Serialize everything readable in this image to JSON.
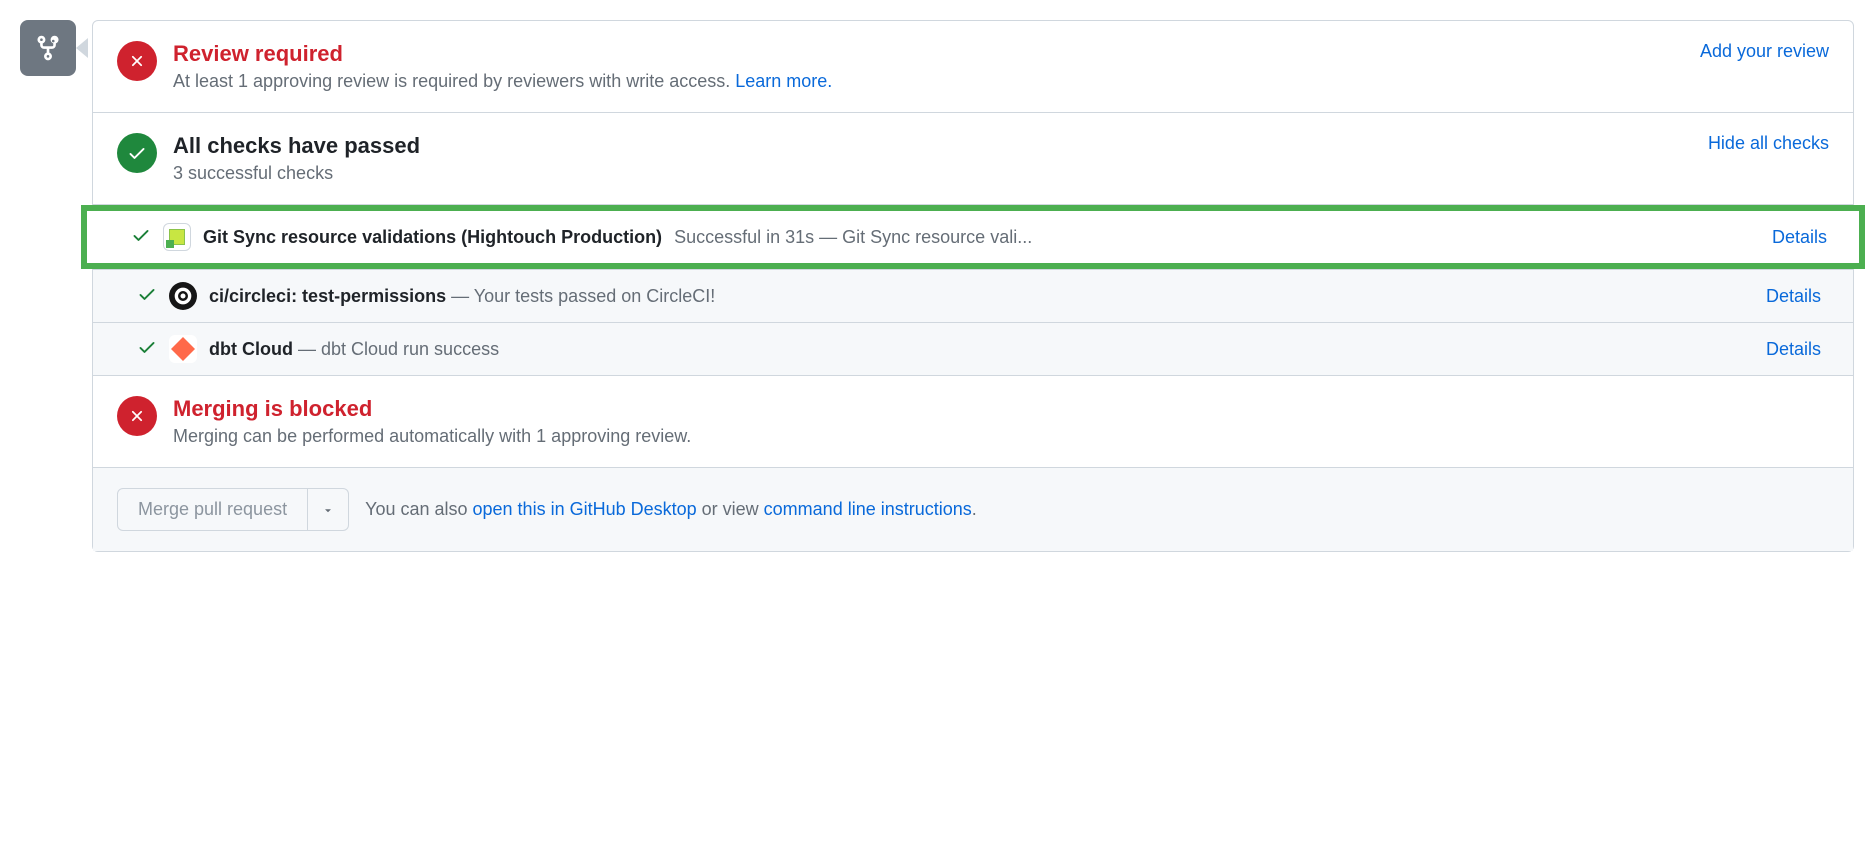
{
  "review": {
    "title": "Review required",
    "subtitle": "At least 1 approving review is required by reviewers with write access. ",
    "learn_more": "Learn more.",
    "action": "Add your review"
  },
  "checks": {
    "title": "All checks have passed",
    "subtitle": "3 successful checks",
    "action": "Hide all checks",
    "items": [
      {
        "name": "Git Sync resource validations (Hightouch Production)",
        "meta": "Successful in 31s — Git Sync resource vali...",
        "details": "Details"
      },
      {
        "name": "ci/circleci: test-permissions",
        "meta": " — Your tests passed on CircleCI!",
        "details": "Details"
      },
      {
        "name": "dbt Cloud",
        "meta": " — dbt Cloud run success",
        "details": "Details"
      }
    ]
  },
  "merge_blocked": {
    "title": "Merging is blocked",
    "subtitle": "Merging can be performed automatically with 1 approving review."
  },
  "merge_actions": {
    "button": "Merge pull request",
    "text_prefix": "You can also ",
    "desktop_link": "open this in GitHub Desktop",
    "text_mid": " or view ",
    "cli_link": "command line instructions",
    "text_suffix": "."
  }
}
